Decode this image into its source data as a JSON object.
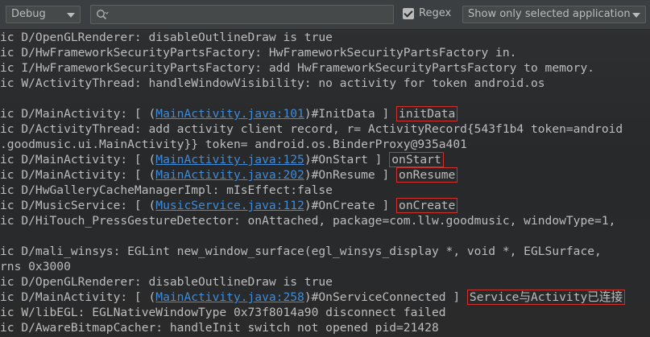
{
  "toolbar": {
    "log_level": "Debug",
    "search_placeholder": "",
    "regex_label": "Regex",
    "regex_checked": true,
    "app_filter": "Show only selected application"
  },
  "icons": {
    "log_level_arrow": "chevron-down-icon",
    "search": "search-icon",
    "regex_checkbox": "checkmark-icon",
    "app_filter_arrow": "chevron-down-icon"
  },
  "colors": {
    "background": "#2b2b2b",
    "text": "#bdbdbd",
    "link": "#3f8bd8",
    "highlight_box": "#d0312d"
  },
  "log_lines": [
    {
      "segments": [
        {
          "text": "ic D/OpenGLRenderer: disableOutlineDraw is true"
        }
      ]
    },
    {
      "segments": [
        {
          "text": "ic D/HwFrameworkSecurityPartsFactory: HwFrameworkSecurityPartsFactory in."
        }
      ]
    },
    {
      "segments": [
        {
          "text": "ic I/HwFrameworkSecurityPartsFactory: add HwFrameworkSecurityPartsFactory to memory."
        }
      ]
    },
    {
      "segments": [
        {
          "text": "ic W/ActivityThread: handleWindowVisibility: no activity for token android.os"
        }
      ]
    },
    {
      "segments": [
        {
          "text": ""
        }
      ]
    },
    {
      "segments": [
        {
          "text": "ic D/MainActivity: [ ("
        },
        {
          "text": "MainActivity.java:101",
          "link": true
        },
        {
          "text": ")#InitData ] "
        },
        {
          "text": "initData",
          "highlight": true
        }
      ]
    },
    {
      "segments": [
        {
          "text": "ic D/ActivityThread: add activity client record, r= ActivityRecord{543f1b4 token=android"
        }
      ]
    },
    {
      "segments": [
        {
          "text": ".goodmusic.ui.MainActivity}} token= android.os.BinderProxy@935a401"
        }
      ]
    },
    {
      "segments": [
        {
          "text": "ic D/MainActivity: [ ("
        },
        {
          "text": "MainActivity.java:125",
          "link": true
        },
        {
          "text": ")#OnStart ] "
        },
        {
          "text": "onStart",
          "highlight": true
        }
      ]
    },
    {
      "segments": [
        {
          "text": "ic D/MainActivity: [ ("
        },
        {
          "text": "MainActivity.java:202",
          "link": true
        },
        {
          "text": ")#OnResume ] "
        },
        {
          "text": "onResume",
          "highlight": true
        }
      ]
    },
    {
      "segments": [
        {
          "text": "ic D/HwGalleryCacheManagerImpl: mIsEffect:false"
        }
      ]
    },
    {
      "segments": [
        {
          "text": "ic D/MusicService: [ ("
        },
        {
          "text": "MusicService.java:112",
          "link": true
        },
        {
          "text": ")#OnCreate ] "
        },
        {
          "text": "onCreate",
          "highlight": true
        }
      ]
    },
    {
      "segments": [
        {
          "text": "ic D/HiTouch_PressGestureDetector: onAttached, package=com.llw.goodmusic, windowType=1,"
        }
      ]
    },
    {
      "segments": [
        {
          "text": ""
        }
      ]
    },
    {
      "segments": [
        {
          "text": "ic D/mali_winsys: EGLint new_window_surface(egl_winsys_display *, void *, EGLSurface,"
        }
      ]
    },
    {
      "segments": [
        {
          "text": "rns 0x3000"
        }
      ]
    },
    {
      "segments": [
        {
          "text": "ic D/OpenGLRenderer: disableOutlineDraw is true"
        }
      ]
    },
    {
      "segments": [
        {
          "text": "ic D/MainActivity: [ ("
        },
        {
          "text": "MainActivity.java:258",
          "link": true
        },
        {
          "text": ")#OnServiceConnected ] "
        },
        {
          "text": "Service与Activity已连接",
          "highlight": true
        }
      ]
    },
    {
      "segments": [
        {
          "text": "ic W/libEGL: EGLNativeWindowType 0x73f8014a90 disconnect failed"
        }
      ]
    },
    {
      "segments": [
        {
          "text": "ic D/AwareBitmapCacher: handleInit switch not opened pid=21428"
        }
      ]
    }
  ]
}
